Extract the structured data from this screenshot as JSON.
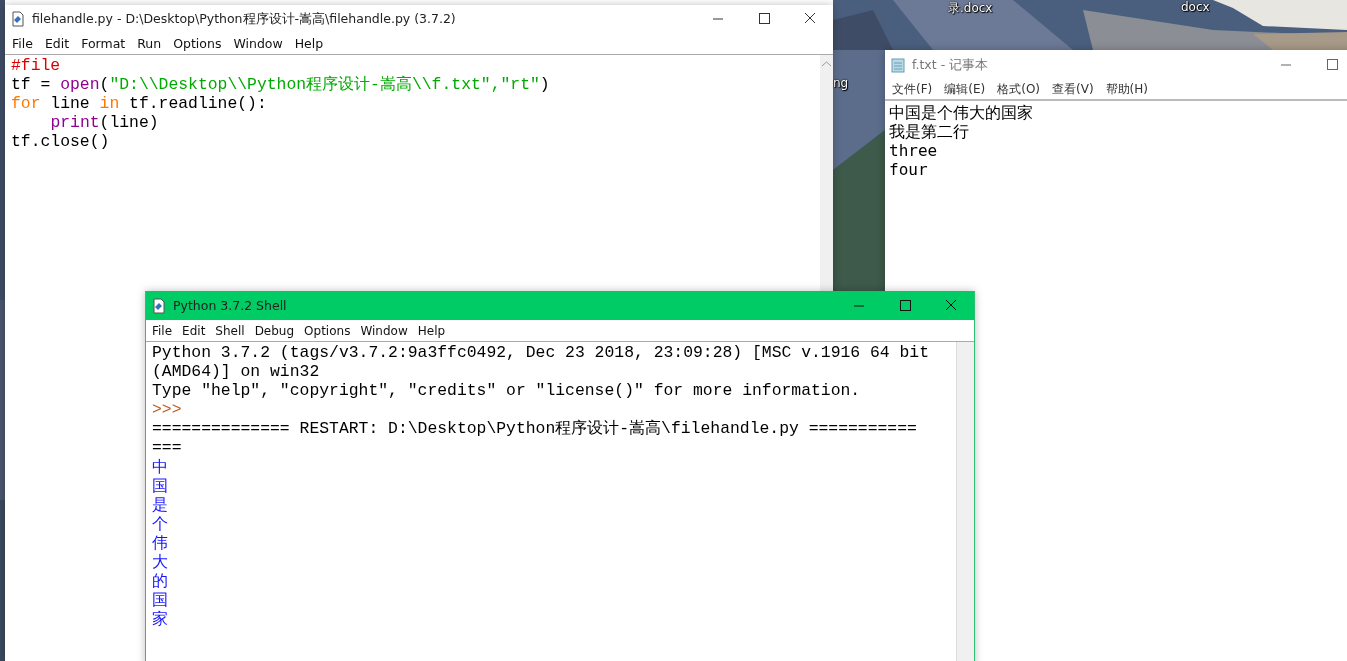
{
  "desktop": {
    "icon_labels": [
      "录.docx",
      "docx",
      "ng"
    ]
  },
  "editor": {
    "title": "filehandle.py - D:\\Desktop\\Python程序设计-嵩高\\filehandle.py (3.7.2)",
    "menu": [
      "File",
      "Edit",
      "Format",
      "Run",
      "Options",
      "Window",
      "Help"
    ],
    "lines": [
      {
        "tokens": [
          {
            "kind": "comment",
            "text": "#file"
          }
        ]
      },
      {
        "tokens": [
          {
            "kind": "plain",
            "text": "tf = "
          },
          {
            "kind": "builtin",
            "text": "open"
          },
          {
            "kind": "plain",
            "text": "("
          },
          {
            "kind": "string",
            "text": "\"D:\\\\Desktop\\\\Python程序设计-嵩高\\\\f.txt\",\"rt\""
          },
          {
            "kind": "plain",
            "text": ")"
          }
        ]
      },
      {
        "tokens": [
          {
            "kind": "keyword",
            "text": "for"
          },
          {
            "kind": "plain",
            "text": " line "
          },
          {
            "kind": "keyword",
            "text": "in"
          },
          {
            "kind": "plain",
            "text": " tf.readline():"
          }
        ],
        "children": [
          {
            "tokens": [
              {
                "kind": "builtin",
                "text": "print"
              },
              {
                "kind": "plain",
                "text": "(line)"
              }
            ]
          }
        ]
      },
      {
        "tokens": [
          {
            "kind": "plain",
            "text": "tf.close()"
          }
        ]
      }
    ]
  },
  "notepad": {
    "title": "f.txt - 记事本",
    "menu": [
      "文件(F)",
      "编辑(E)",
      "格式(O)",
      "查看(V)",
      "帮助(H)"
    ],
    "lines": [
      "中国是个伟大的国家",
      "我是第二行",
      "three",
      "four"
    ]
  },
  "shell": {
    "title": "Python 3.7.2 Shell",
    "menu": [
      "File",
      "Edit",
      "Shell",
      "Debug",
      "Options",
      "Window",
      "Help"
    ],
    "lines": [
      {
        "kind": "plain",
        "text": "Python 3.7.2 (tags/v3.7.2:9a3ffc0492, Dec 23 2018, 23:09:28) [MSC v.1916 64 bit"
      },
      {
        "kind": "plain",
        "text": "(AMD64)] on win32"
      },
      {
        "kind": "plain",
        "text": "Type \"help\", \"copyright\", \"credits\" or \"license()\" for more information."
      },
      {
        "kind": "prompt",
        "text": ">>>"
      },
      {
        "kind": "plain",
        "text": "============== RESTART: D:\\Desktop\\Python程序设计-嵩高\\filehandle.py ==========="
      },
      {
        "kind": "plain",
        "text": "==="
      },
      {
        "kind": "output",
        "text": "中"
      },
      {
        "kind": "output",
        "text": "国"
      },
      {
        "kind": "output",
        "text": "是"
      },
      {
        "kind": "output",
        "text": "个"
      },
      {
        "kind": "output",
        "text": "伟"
      },
      {
        "kind": "output",
        "text": "大"
      },
      {
        "kind": "output",
        "text": "的"
      },
      {
        "kind": "output",
        "text": "国"
      },
      {
        "kind": "output",
        "text": "家"
      }
    ]
  }
}
